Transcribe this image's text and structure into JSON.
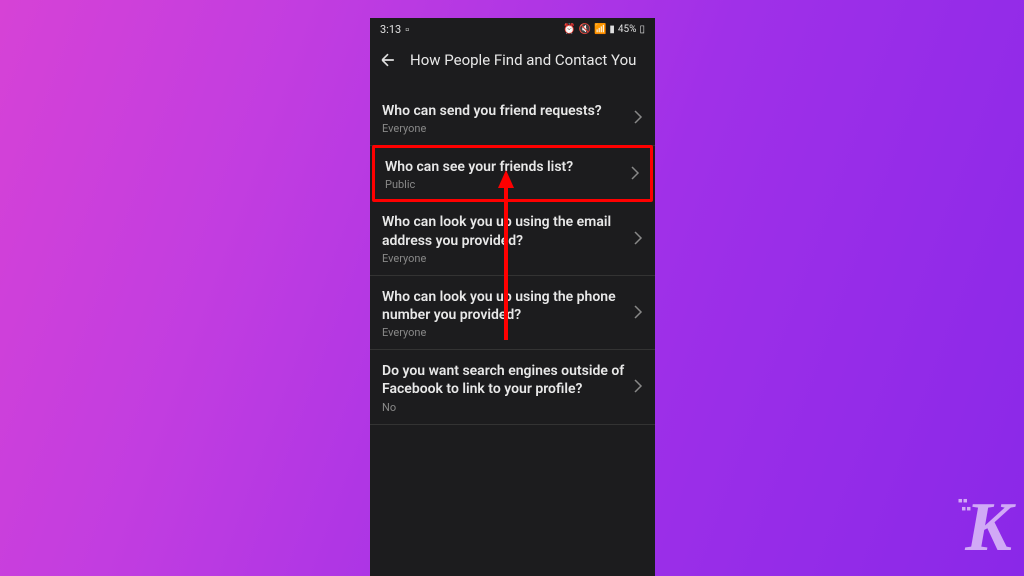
{
  "status_bar": {
    "time": "3:13",
    "battery": "45%"
  },
  "header": {
    "title": "How People Find and Contact You"
  },
  "settings": [
    {
      "title": "Who can send you friend requests?",
      "value": "Everyone",
      "highlighted": false
    },
    {
      "title": "Who can see your friends list?",
      "value": "Public",
      "highlighted": true
    },
    {
      "title": "Who can look you up using the email address you provided?",
      "value": "Everyone",
      "highlighted": false
    },
    {
      "title": "Who can look you up using the phone number you provided?",
      "value": "Everyone",
      "highlighted": false
    },
    {
      "title": "Do you want search engines outside of Facebook to link to your profile?",
      "value": "No",
      "highlighted": false
    }
  ],
  "watermark": "K"
}
